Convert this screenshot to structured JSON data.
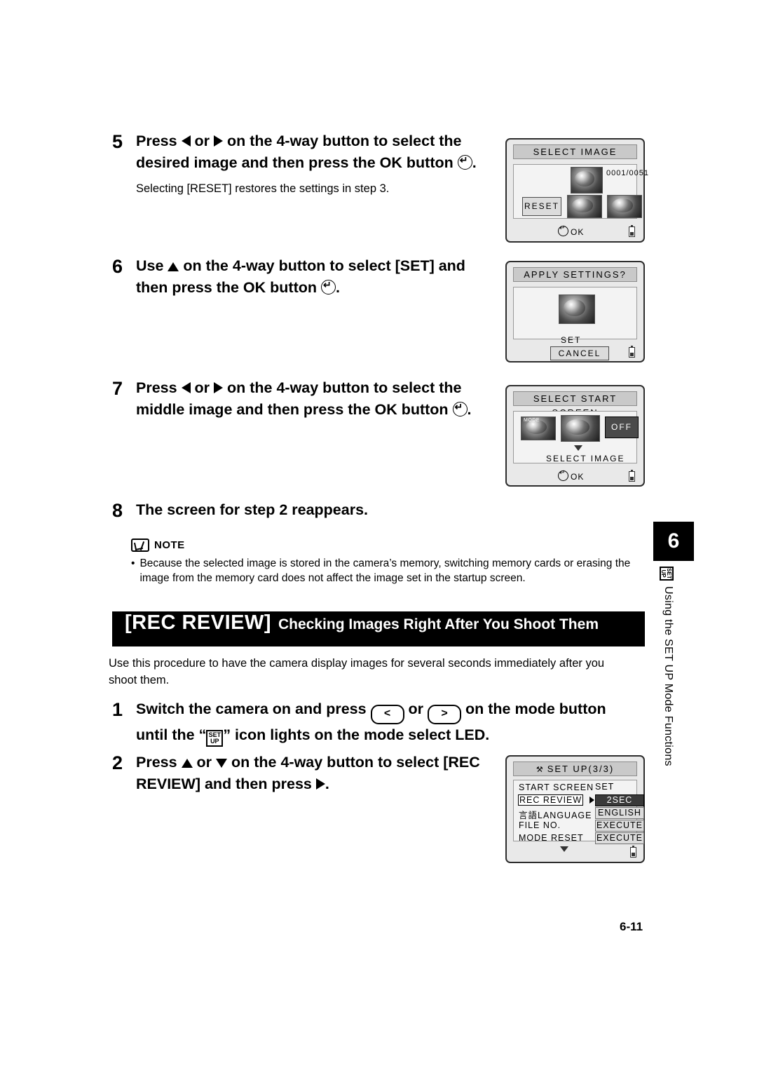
{
  "steps": [
    {
      "num": "5",
      "text_parts": [
        "Press ",
        " or ",
        " on the 4-way button to select the desired image and then press the OK button ",
        "."
      ],
      "sub": "Selecting [RESET] restores the settings in step 3."
    },
    {
      "num": "6",
      "text_parts": [
        "Use ",
        " on the 4-way button to select [SET] and then press the OK button ",
        "."
      ]
    },
    {
      "num": "7",
      "text_parts": [
        "Press ",
        " or ",
        " on the 4-way button to select the middle image and then press the OK button ",
        "."
      ]
    },
    {
      "num": "8",
      "text": "The screen for step 2 reappears."
    }
  ],
  "screens": {
    "select_image": {
      "title": "SELECT IMAGE",
      "counter": "0001/0051",
      "reset_label": "RESET",
      "ok_label": "OK"
    },
    "apply_settings": {
      "title": "APPLY SETTINGS?",
      "set_label": "SET",
      "cancel_label": "CANCEL"
    },
    "select_start_screen": {
      "title": "SELECT START SCREEN",
      "off_label": "OFF",
      "caption": "SELECT IMAGE",
      "ok_label": "OK",
      "thumb1_label": "MODE"
    },
    "setup3": {
      "title": "SET UP(3/3)",
      "rows": [
        {
          "label": "START SCREEN",
          "value": "SET",
          "selected": false
        },
        {
          "label": "REC REVIEW",
          "value": "2SEC",
          "selected": true
        },
        {
          "label": "言語LANGUAGE",
          "value": "ENGLISH",
          "selected": false
        },
        {
          "label": "FILE NO.",
          "value": "EXECUTE",
          "selected": false
        },
        {
          "label": "MODE RESET",
          "value": "EXECUTE",
          "selected": false
        }
      ]
    }
  },
  "note": {
    "label": "NOTE",
    "bullet": "•",
    "text": "Because the selected image is stored in the camera’s memory, switching memory cards or erasing the image from the memory card does not affect the image set in the startup screen."
  },
  "section": {
    "title_main": "[REC REVIEW]",
    "title_sub": "Checking Images Right After You Shoot Them",
    "intro": "Use this procedure to have the camera display images for several seconds immediately after you shoot them."
  },
  "steps2": [
    {
      "num": "1",
      "part1": "Switch the camera on and press ",
      "btn_left": "<",
      "part2": " or ",
      "btn_right": ">",
      "part3": " on the mode button until the “",
      "icon_top": "SET",
      "icon_bottom": "UP",
      "part4": "” icon lights on the mode select LED."
    },
    {
      "num": "2",
      "part1": "Press ",
      "part2": " or ",
      "part3": " on the 4-way button to select [REC REVIEW] and then press ",
      "part4": "."
    }
  ],
  "sidebar": {
    "chapter": "6",
    "icon_top": "SET",
    "icon_bottom": "UP",
    "text": "Using the SET UP Mode Functions"
  },
  "footer": {
    "page": "6-11"
  }
}
